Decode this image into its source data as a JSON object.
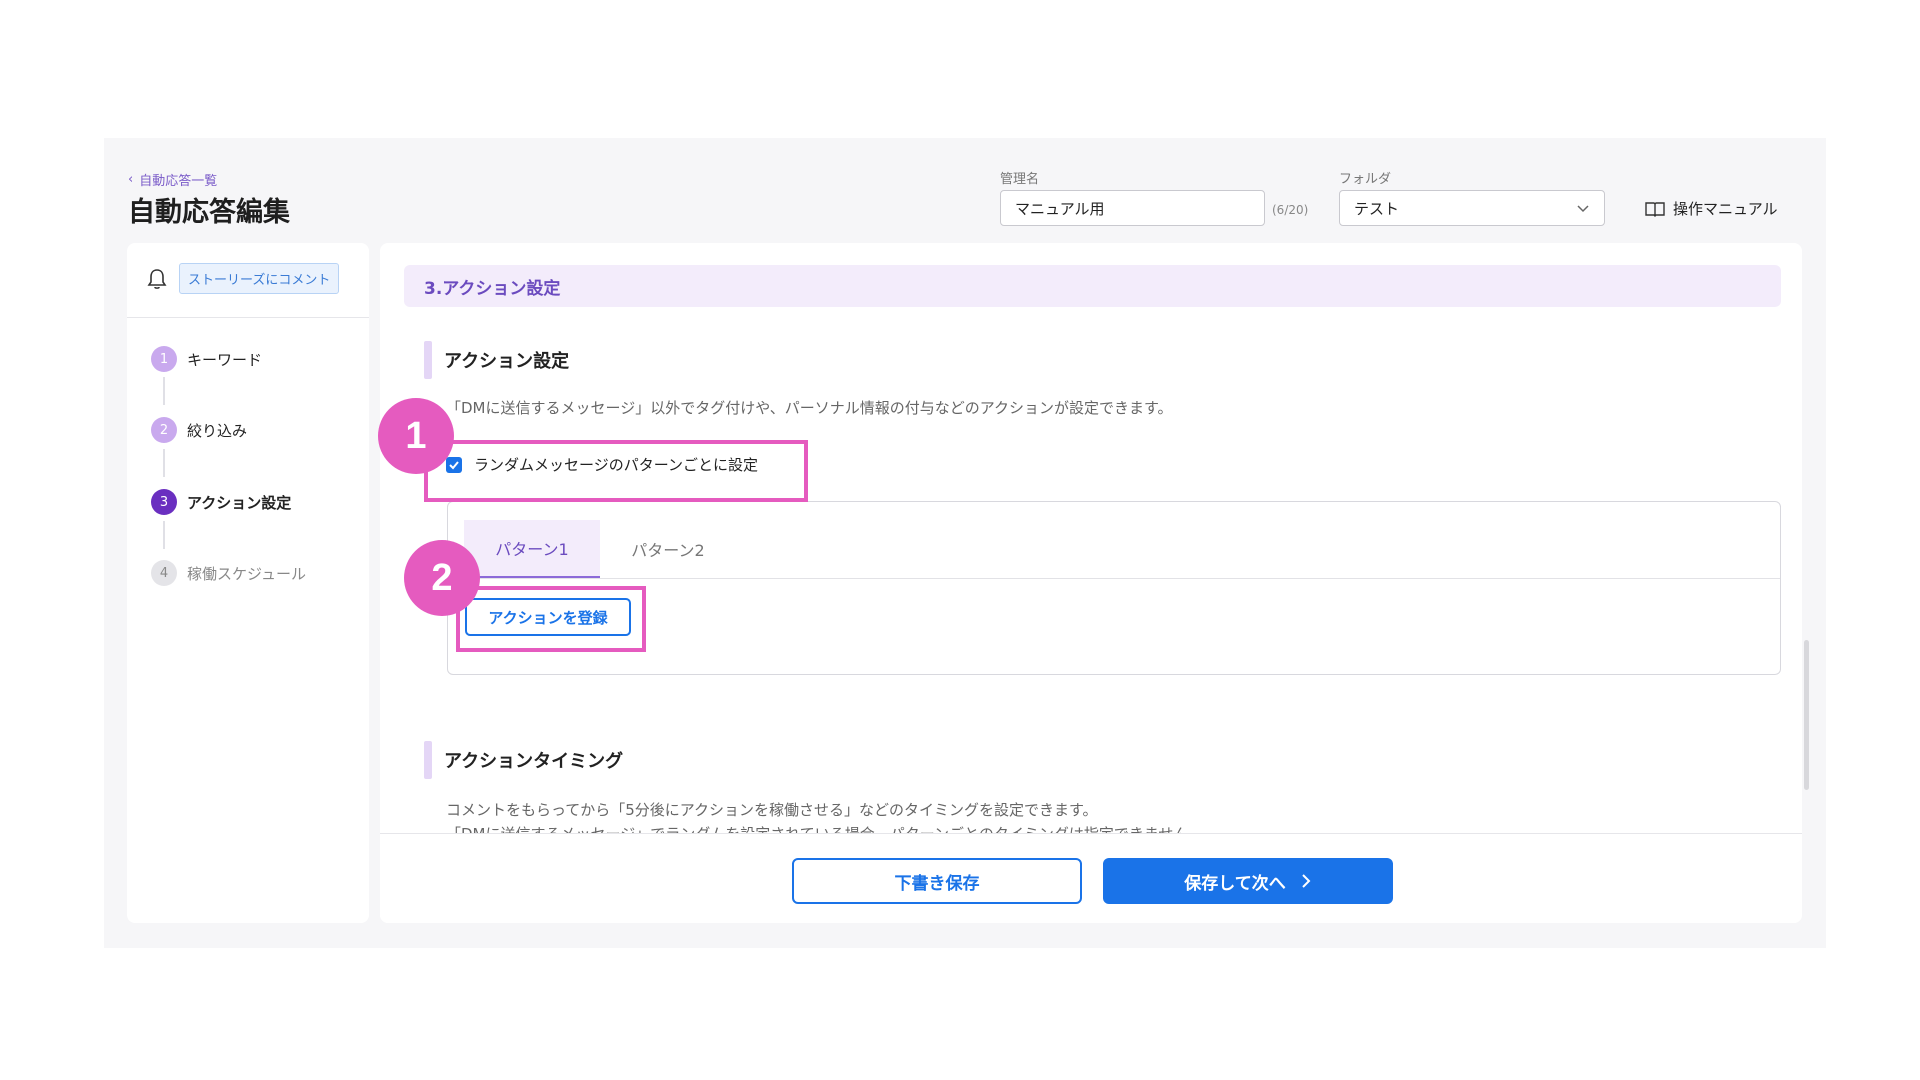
{
  "header": {
    "breadcrumb": "自動応答一覧",
    "title": "自動応答編集",
    "name_label": "管理名",
    "name_value": "マニュアル用",
    "name_count": "(6/20)",
    "folder_label": "フォルダ",
    "folder_value": "テスト",
    "manual_link": "操作マニュアル"
  },
  "sidebar": {
    "trigger_tag": "ストーリーズにコメント",
    "steps": [
      {
        "num": "1",
        "label": "キーワード"
      },
      {
        "num": "2",
        "label": "絞り込み"
      },
      {
        "num": "3",
        "label": "アクション設定"
      },
      {
        "num": "4",
        "label": "稼働スケジュール"
      }
    ]
  },
  "main": {
    "section_title": "3.アクション設定",
    "action_heading": "アクション設定",
    "action_desc": "「DMに送信するメッセージ」以外でタグ付けや、パーソナル情報の付与などのアクションが設定できます。",
    "pattern_checkbox_label": "ランダムメッセージのパターンごとに設定",
    "tabs": [
      "パターン1",
      "パターン2"
    ],
    "register_button": "アクションを登録",
    "timing_heading": "アクションタイミング",
    "timing_desc": "コメントをもらってから「5分後にアクションを稼働させる」などのタイミングを設定できます。",
    "timing_desc_2": "「DMに送信するメッセージ」でランダムを設定されている場合、パターンごとのタイミングは指定できません。"
  },
  "footer": {
    "draft_button": "下書き保存",
    "next_button": "保存して次へ"
  },
  "annotations": [
    "1",
    "2"
  ],
  "colors": {
    "accent": "#1a73e8",
    "purple": "#6b4bbf",
    "annotation": "#e55bbf"
  }
}
